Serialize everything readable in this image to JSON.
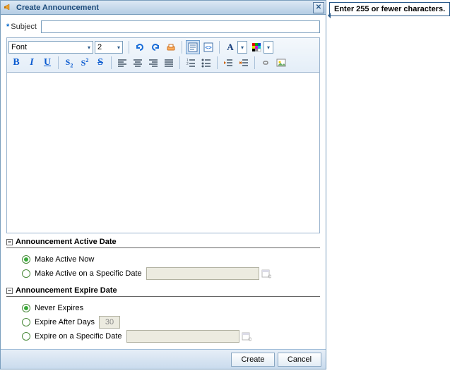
{
  "dialog": {
    "title": "Create Announcement"
  },
  "subject": {
    "label": "Subject",
    "value": ""
  },
  "toolbar": {
    "font_family": "Font",
    "font_size": "2"
  },
  "sections": {
    "active": {
      "title": "Announcement Active Date",
      "options": [
        "Make Active Now",
        "Make Active on a Specific Date"
      ],
      "selected": 0,
      "date_value": ""
    },
    "expire": {
      "title": "Announcement Expire Date",
      "options": [
        "Never Expires",
        "Expire After Days",
        "Expire on a Specific Date"
      ],
      "selected": 0,
      "days_value": "30",
      "date_value": ""
    }
  },
  "footer": {
    "create": "Create",
    "cancel": "Cancel"
  },
  "tooltip": {
    "text": "Enter 255 or fewer characters."
  }
}
